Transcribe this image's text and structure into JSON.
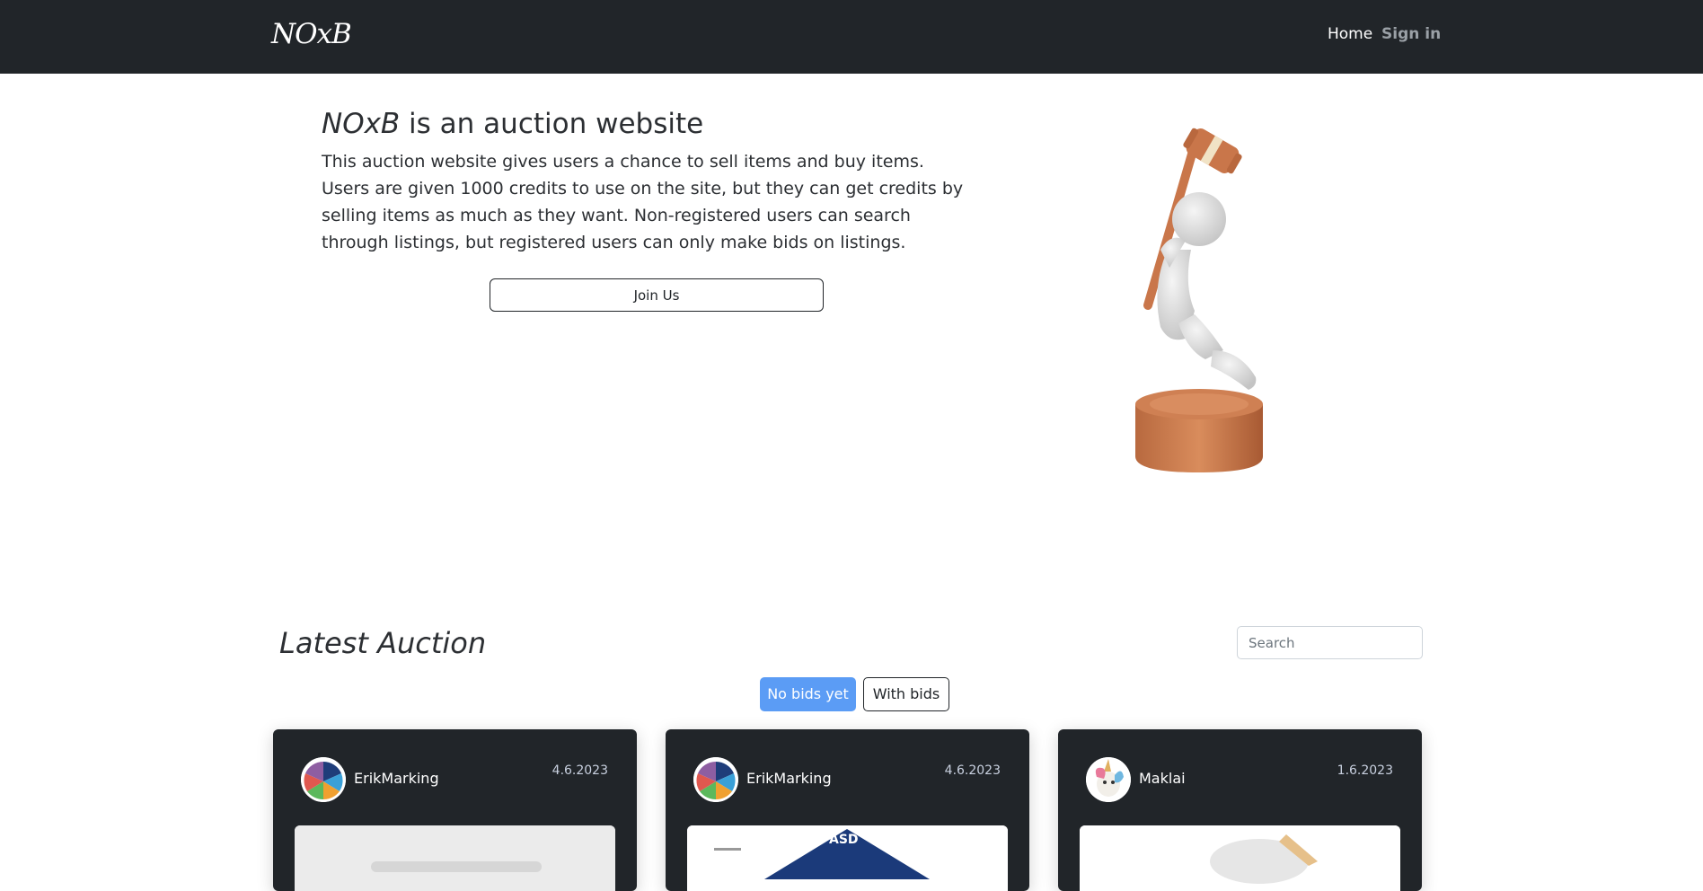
{
  "nav": {
    "brand": "NOxB",
    "links": [
      {
        "label": "Home",
        "active": true
      },
      {
        "label": "Sign in",
        "active": false
      }
    ]
  },
  "hero": {
    "title_brand": "NOxB",
    "title_rest": " is an auction website",
    "description": "This auction website gives users a chance to sell items and buy items. Users are given 1000 credits to use on the site, but they can get credits by selling items as much as they want. Non-registered users can search through listings, but registered users can only make bids on listings.",
    "join_label": "Join Us",
    "image": "auction-gavel-figure-illustration"
  },
  "auctions": {
    "heading": "Latest Auction",
    "search_placeholder": "Search",
    "search_value": "",
    "filters": [
      {
        "label": "No bids yet",
        "active": true
      },
      {
        "label": "With bids",
        "active": false
      }
    ],
    "listings": [
      {
        "seller": "ErikMarking",
        "date": "4.6.2023",
        "avatar": "pie-chart-avatar",
        "thumbnail": "gray-placeholder-thumbnail"
      },
      {
        "seller": "ErikMarking",
        "date": "4.6.2023",
        "avatar": "pie-chart-avatar",
        "thumbnail_text": "ASD"
      },
      {
        "seller": "Maklai",
        "date": "1.6.2023",
        "avatar": "unicorn-avatar",
        "thumbnail": "item-photo-thumbnail"
      }
    ]
  },
  "colors": {
    "navbar_bg": "#212529",
    "primary": "#5b9cf5",
    "card_bg": "#212529",
    "wood": "#c9764a",
    "figure": "#dcdcdc"
  }
}
